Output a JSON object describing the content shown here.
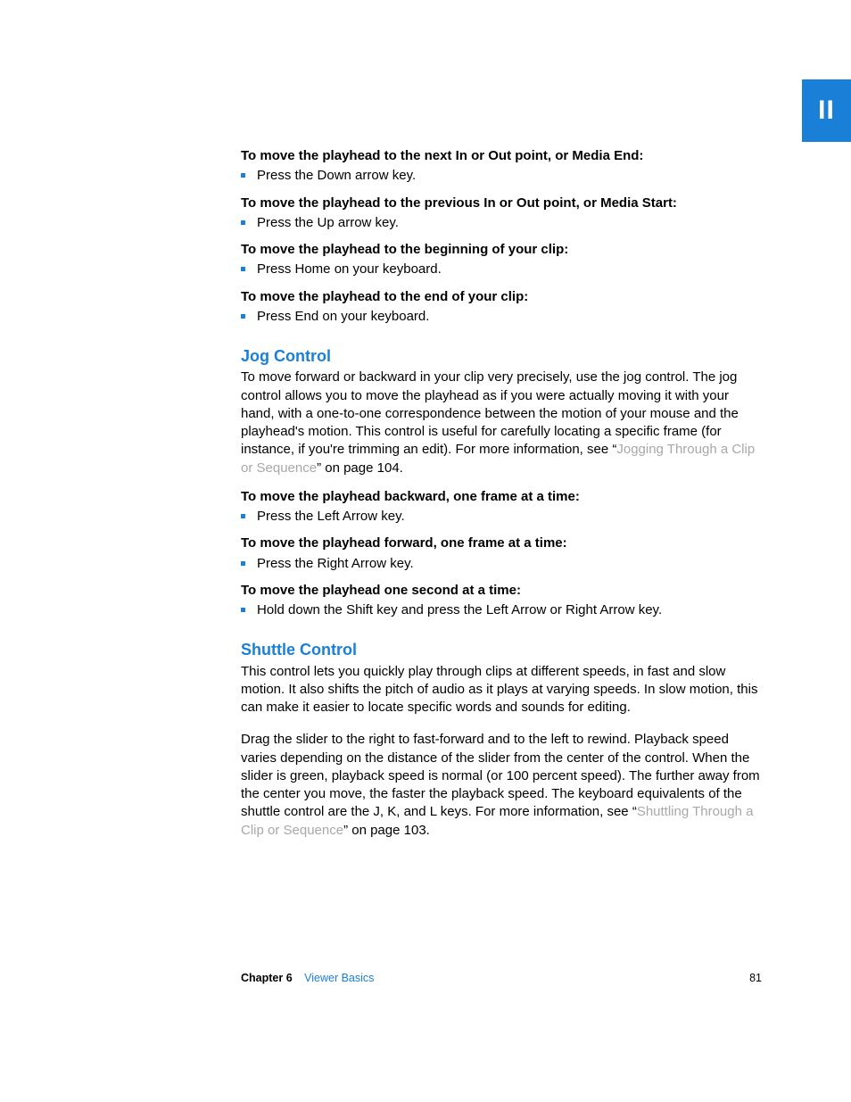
{
  "tab": "II",
  "blocks": [
    {
      "intro": "To move the playhead to the next In or Out point, or Media End:",
      "item": "Press the Down arrow key."
    },
    {
      "intro": "To move the playhead to the previous In or Out point, or Media Start:",
      "item": "Press the Up arrow key."
    },
    {
      "intro": "To move the playhead to the beginning of your clip:",
      "item": "Press Home on your keyboard."
    },
    {
      "intro": "To move the playhead to the end of your clip:",
      "item": "Press End on your keyboard."
    }
  ],
  "jog": {
    "heading": "Jog Control",
    "para_pre": "To move forward or backward in your clip very precisely, use the jog control. The jog control allows you to move the playhead as if you were actually moving it with your hand, with a one-to-one correspondence between the motion of your mouse and the playhead's motion. This control is useful for carefully locating a specific frame (for instance, if you're trimming an edit). For more information, see “",
    "link": "Jogging Through a Clip or Sequence",
    "para_post": "” on page 104.",
    "steps": [
      {
        "intro": "To move the playhead backward, one frame at a time:",
        "item": "Press the Left Arrow key."
      },
      {
        "intro": "To move the playhead forward, one frame at a time:",
        "item": "Press the Right Arrow key."
      },
      {
        "intro": "To move the playhead one second at a time:",
        "item": "Hold down the Shift key and press the Left Arrow or Right Arrow key."
      }
    ]
  },
  "shuttle": {
    "heading": "Shuttle Control",
    "para1": "This control lets you quickly play through clips at different speeds, in fast and slow motion. It also shifts the pitch of audio as it plays at varying speeds. In slow motion, this can make it easier to locate specific words and sounds for editing.",
    "para2_pre": "Drag the slider to the right to fast-forward and to the left to rewind. Playback speed varies depending on the distance of the slider from the center of the control. When the slider is green, playback speed is normal (or 100 percent speed). The further away from the center you move, the faster the playback speed. The keyboard equivalents of the shuttle control are the J, K, and L keys. For more information, see “",
    "link": "Shuttling Through a Clip or Sequence",
    "para2_post": "” on page 103."
  },
  "footer": {
    "chapter": "Chapter 6",
    "title": "Viewer Basics",
    "page": "81"
  }
}
